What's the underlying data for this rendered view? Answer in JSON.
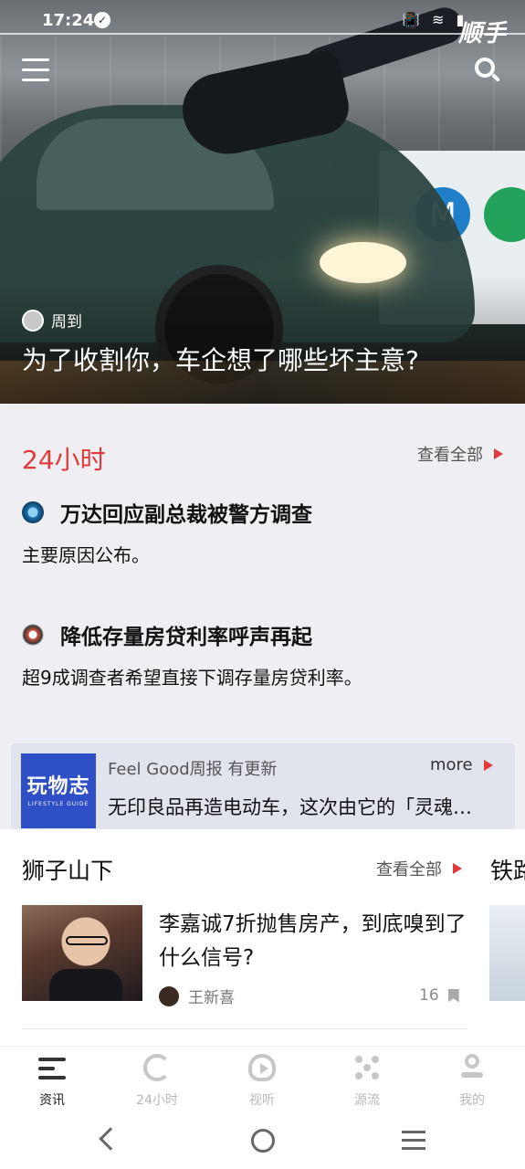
{
  "status_bar": {
    "time": "17:24",
    "check_glyph": "✓",
    "right_icons_text": "📳 ≋ ▮",
    "app_logo_text": "顺手"
  },
  "hero": {
    "author": "周到",
    "title": "为了收割你，车企想了哪些坏主意?",
    "banner_letter": "M"
  },
  "section_24h": {
    "title": "24小时",
    "see_all": "查看全部",
    "items": [
      {
        "title": "万达回应副总裁被警方调查",
        "desc": "主要原因公布。"
      },
      {
        "title": "降低存量房贷利率呼声再起",
        "desc": "超9成调查者希望直接下调存量房贷利率。"
      }
    ]
  },
  "promo": {
    "logo_text": "玩物志",
    "logo_sub": "LIFESTYLE GUIDE",
    "source": "Feel Good周报 有更新",
    "more": "more",
    "text": "无印良品再造电动车，这次由它的「灵魂…"
  },
  "section_lion": {
    "title": "狮子山下",
    "see_all": "查看全部",
    "next_title": "铁路",
    "article": {
      "title": "李嘉诚7折抛售房产，到底嗅到了什么信号?",
      "author": "王新喜",
      "count": "16"
    }
  },
  "tabbar": {
    "tabs": [
      {
        "label": "资讯"
      },
      {
        "label": "24小时"
      },
      {
        "label": "视听"
      },
      {
        "label": "源流"
      },
      {
        "label": "我的"
      }
    ]
  },
  "colors": {
    "accent_red": "#e03a3a",
    "promo_blue": "#2f4fc6",
    "background": "#efeff3"
  }
}
